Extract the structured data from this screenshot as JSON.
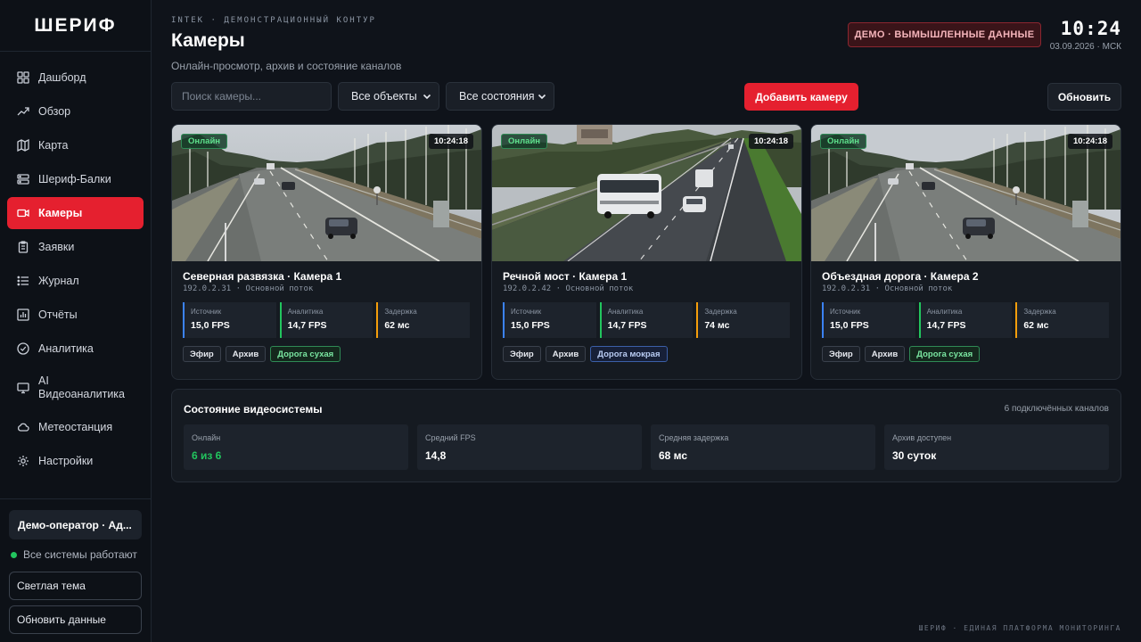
{
  "app": {
    "logo": "ШЕРИФ"
  },
  "sidebar": {
    "items": [
      {
        "label": "Дашборд",
        "icon": "grid-icon"
      },
      {
        "label": "Обзор",
        "icon": "trend-icon"
      },
      {
        "label": "Карта",
        "icon": "map-icon"
      },
      {
        "label": "Шериф-Балки",
        "icon": "server-icon"
      },
      {
        "label": "Камеры",
        "icon": "video-icon",
        "active": true
      },
      {
        "label": "Заявки",
        "icon": "clipboard-icon"
      },
      {
        "label": "Журнал",
        "icon": "list-icon"
      },
      {
        "label": "Отчёты",
        "icon": "bar-chart-icon"
      },
      {
        "label": "Аналитика",
        "icon": "check-circle-icon"
      },
      {
        "label": "AI Видеоаналитика",
        "icon": "monitor-icon"
      },
      {
        "label": "Метеостанция",
        "icon": "cloud-icon"
      },
      {
        "label": "Настройки",
        "icon": "gear-icon"
      }
    ],
    "user": "Демо-оператор · Ад...",
    "system_status": "Все системы работают",
    "theme_button": "Светлая тема",
    "refresh_button": "Обновить данные"
  },
  "header": {
    "kicker": "INTEK · ДЕМОНСТРАЦИОННЫЙ КОНТУР",
    "title": "Камеры",
    "subtitle": "Онлайн-просмотр, архив и состояние каналов",
    "demo_badge": "ДЕМО · ВЫМЫШЛЕННЫЕ ДАННЫЕ",
    "clock": "10:24",
    "date": "03.09.2026 · МСК"
  },
  "toolbar": {
    "search_placeholder": "Поиск камеры...",
    "objects_filter": "Все объекты",
    "state_filter": "Все состояния",
    "add_button": "Добавить камеру",
    "refresh_button": "Обновить"
  },
  "cameras": [
    {
      "name": "Северная развязка · Камера 1",
      "meta": "192.0.2.31 · Основной поток",
      "status": "Онлайн",
      "time": "10:24:18",
      "metrics": [
        {
          "label": "Источник",
          "value": "15,0 FPS"
        },
        {
          "label": "Аналитика",
          "value": "14,7 FPS"
        },
        {
          "label": "Задержка",
          "value": "62 мс"
        }
      ],
      "tags": [
        "Эфир",
        "Архив"
      ],
      "road": "Дорога сухая"
    },
    {
      "name": "Речной мост · Камера 1",
      "meta": "192.0.2.42 · Основной поток",
      "status": "Онлайн",
      "time": "10:24:18",
      "metrics": [
        {
          "label": "Источник",
          "value": "15,0 FPS"
        },
        {
          "label": "Аналитика",
          "value": "14,7 FPS"
        },
        {
          "label": "Задержка",
          "value": "74 мс"
        }
      ],
      "tags": [
        "Эфир",
        "Архив"
      ],
      "road": "Дорога мокрая"
    },
    {
      "name": "Объездная дорога · Камера 2",
      "meta": "192.0.2.31 · Основной поток",
      "status": "Онлайн",
      "time": "10:24:18",
      "metrics": [
        {
          "label": "Источник",
          "value": "15,0 FPS"
        },
        {
          "label": "Аналитика",
          "value": "14,7 FPS"
        },
        {
          "label": "Задержка",
          "value": "62 мс"
        }
      ],
      "tags": [
        "Эфир",
        "Архив"
      ],
      "road": "Дорога сухая"
    }
  ],
  "video_status": {
    "title": "Состояние видеосистемы",
    "channels": "6 подключённых каналов",
    "stats": [
      {
        "label": "Онлайн",
        "value": "6 из 6"
      },
      {
        "label": "Средний FPS",
        "value": "14,8"
      },
      {
        "label": "Средняя задержка",
        "value": "68 мс"
      },
      {
        "label": "Архив доступен",
        "value": "30 суток"
      }
    ]
  },
  "footer": "ШЕРИФ · ЕДИНАЯ ПЛАТФОРМА МОНИТОРИНГА",
  "colors": {
    "accent": "#e5202f",
    "online": "#22c55e",
    "background": "#0f131a"
  }
}
